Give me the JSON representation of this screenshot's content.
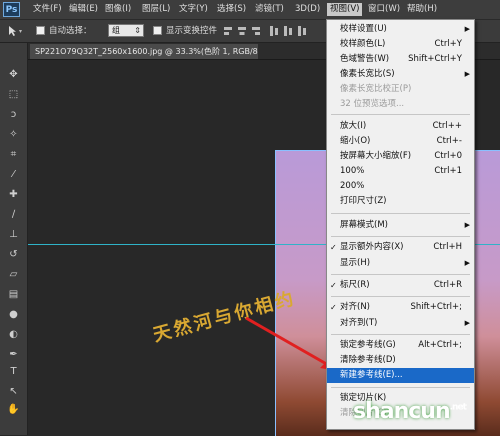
{
  "app": {
    "logo": "Ps"
  },
  "menubar": {
    "items": [
      "文件(F)",
      "编辑(E)",
      "图像(I)",
      "图层(L)",
      "文字(Y)",
      "选择(S)",
      "滤镜(T)",
      "3D(D)",
      "视图(V)",
      "窗口(W)",
      "帮助(H)"
    ],
    "active_index": 8
  },
  "options": {
    "auto_select_label": "自动选择：",
    "auto_select_value": "组",
    "show_transform_label": "显示变换控件"
  },
  "document": {
    "tab_title": "SP221O79Q32T_2560x1600.jpg @ 33.3%(色阶 1, RGB/8#) *"
  },
  "view_menu": {
    "items": [
      {
        "label": "校样设置(U)",
        "shortcut": "",
        "submenu": true,
        "checked": false,
        "disabled": false
      },
      {
        "label": "校样颜色(L)",
        "shortcut": "Ctrl+Y",
        "submenu": false,
        "checked": false,
        "disabled": false
      },
      {
        "label": "色域警告(W)",
        "shortcut": "Shift+Ctrl+Y",
        "submenu": false,
        "checked": false,
        "disabled": false
      },
      {
        "label": "像素长宽比(S)",
        "shortcut": "",
        "submenu": true,
        "checked": false,
        "disabled": false
      },
      {
        "label": "像素长宽比校正(P)",
        "shortcut": "",
        "submenu": false,
        "checked": false,
        "disabled": true
      },
      {
        "label": "32 位预览选项...",
        "shortcut": "",
        "submenu": false,
        "checked": false,
        "disabled": true
      },
      {
        "label": "放大(I)",
        "shortcut": "Ctrl++",
        "submenu": false,
        "checked": false,
        "disabled": false
      },
      {
        "label": "缩小(O)",
        "shortcut": "Ctrl+-",
        "submenu": false,
        "checked": false,
        "disabled": false
      },
      {
        "label": "按屏幕大小缩放(F)",
        "shortcut": "Ctrl+0",
        "submenu": false,
        "checked": false,
        "disabled": false
      },
      {
        "label": "100%",
        "shortcut": "Ctrl+1",
        "submenu": false,
        "checked": false,
        "disabled": false
      },
      {
        "label": "200%",
        "shortcut": "",
        "submenu": false,
        "checked": false,
        "disabled": false
      },
      {
        "label": "打印尺寸(Z)",
        "shortcut": "",
        "submenu": false,
        "checked": false,
        "disabled": false
      },
      {
        "label": "屏幕模式(M)",
        "shortcut": "",
        "submenu": true,
        "checked": false,
        "disabled": false
      },
      {
        "label": "显示额外内容(X)",
        "shortcut": "Ctrl+H",
        "submenu": false,
        "checked": true,
        "disabled": false
      },
      {
        "label": "显示(H)",
        "shortcut": "",
        "submenu": true,
        "checked": false,
        "disabled": false
      },
      {
        "label": "标尺(R)",
        "shortcut": "Ctrl+R",
        "submenu": false,
        "checked": true,
        "disabled": false
      },
      {
        "label": "对齐(N)",
        "shortcut": "Shift+Ctrl+;",
        "submenu": false,
        "checked": true,
        "disabled": false
      },
      {
        "label": "对齐到(T)",
        "shortcut": "",
        "submenu": true,
        "checked": false,
        "disabled": false
      },
      {
        "label": "锁定参考线(G)",
        "shortcut": "Alt+Ctrl+;",
        "submenu": false,
        "checked": false,
        "disabled": false
      },
      {
        "label": "清除参考线(D)",
        "shortcut": "",
        "submenu": false,
        "checked": false,
        "disabled": false
      },
      {
        "label": "新建参考线(E)...",
        "shortcut": "",
        "submenu": false,
        "checked": false,
        "disabled": false,
        "highlighted": true
      },
      {
        "label": "锁定切片(K)",
        "shortcut": "",
        "submenu": false,
        "checked": false,
        "disabled": false
      },
      {
        "label": "清除切片(C)",
        "shortcut": "",
        "submenu": false,
        "checked": false,
        "disabled": true
      }
    ]
  },
  "watermarks": {
    "handwritten": "天然河与你相约",
    "site_logo": "shancun",
    "site_logo_suffix": ".net"
  },
  "colors": {
    "menu_highlight": "#1a69c8",
    "guide_line": "#2fb3c8",
    "arrow": "#e02020"
  }
}
